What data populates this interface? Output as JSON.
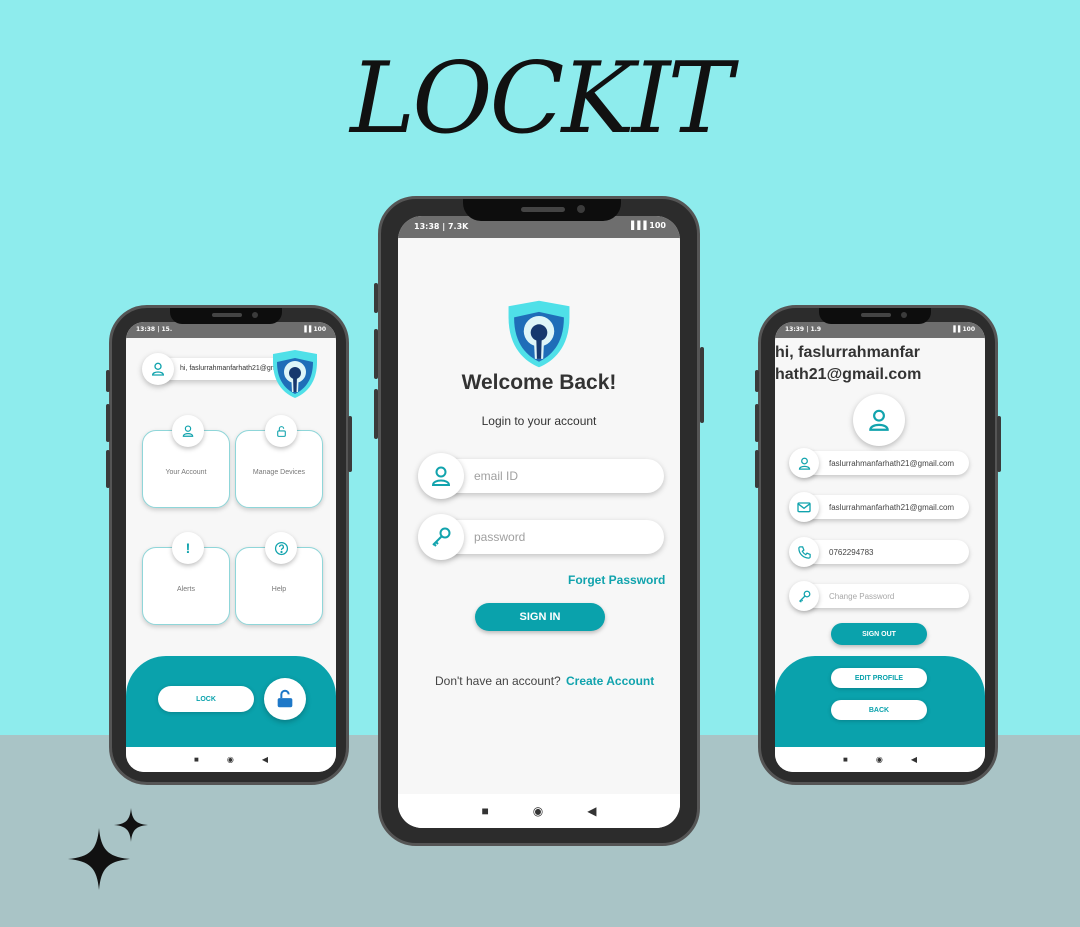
{
  "brand": {
    "title": "LOCKIT"
  },
  "colors": {
    "background": "#8eeced",
    "floor": "#a9c4c6",
    "accent": "#0aa2ac",
    "screen": "#f7f7f7"
  },
  "login_screen": {
    "status_time": "13:38 | 7.3K",
    "status_icons": "▐▐▐ 100",
    "welcome": "Welcome Back!",
    "subtitle": "Login to your account",
    "email_placeholder": "email ID",
    "password_placeholder": "password",
    "forget_password": "Forget Password",
    "sign_in": "SIGN IN",
    "no_account": "Don't have an account?",
    "create_account": "Create Account",
    "nav": [
      "■",
      "◉",
      "◀"
    ]
  },
  "home_screen": {
    "status_time": "13:38 | 15.",
    "status_icons": "▐▐ 100",
    "user_email": "hi, faslurrahmanfarhath21@gmail.com",
    "cards": [
      {
        "label": "Your Account",
        "icon": "user-icon"
      },
      {
        "label": "Manage Devices",
        "icon": "lock-icon"
      },
      {
        "label": "Alerts",
        "icon": "exclamation-icon",
        "glyph": "!"
      },
      {
        "label": "Help",
        "icon": "question-icon"
      }
    ],
    "lock_button": "LOCK",
    "nav": [
      "■",
      "◉",
      "◀"
    ]
  },
  "profile_screen": {
    "status_time": "13:39 | 1.9",
    "status_icons": "▐▐ 100",
    "greeting": "hi, faslurrahmanfarhath21@gmail.com",
    "email": "faslurrahmanfarhath21@gmail.com",
    "email_alt": "faslurrahmanfarhath21@gmail.com",
    "phone": "0762294783",
    "change_password_placeholder": "Change Password",
    "sign_out": "SIGN OUT",
    "edit_profile": "EDIT PROFILE",
    "back": "BACK",
    "nav": [
      "■",
      "◉",
      "◀"
    ]
  }
}
